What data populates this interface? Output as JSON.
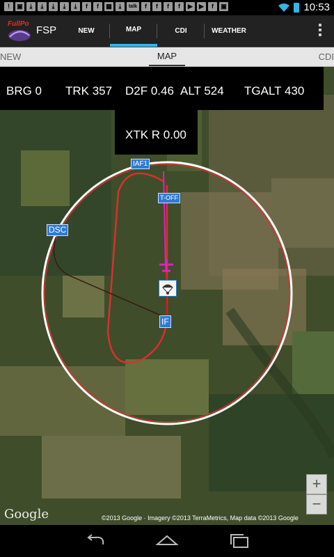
{
  "status_bar": {
    "notification_icons": [
      "notif-alert-icon",
      "image-icon",
      "download-icon",
      "download-icon",
      "download-icon",
      "download-icon",
      "download-icon",
      "facebook-icon",
      "facebook-icon",
      "calendar-icon",
      "download-icon",
      "talk-icon",
      "facebook-icon",
      "facebook-icon",
      "facebook-icon",
      "facebook-icon",
      "media-icon",
      "media-icon",
      "facebook-icon",
      "image-icon"
    ],
    "notification_glyphs": [
      "!",
      "▣",
      "⤓",
      "⤓",
      "⤓",
      "⤓",
      "⤓",
      "f",
      "f",
      "▦",
      "⤓",
      "talk",
      "f",
      "f",
      "f",
      "f",
      "▶",
      "▶",
      "f",
      "▣"
    ],
    "time": "10:53"
  },
  "action_bar": {
    "logo_text": "FullPo",
    "title": "FSP",
    "tabs": [
      {
        "label": "NEW",
        "active": false
      },
      {
        "label": "MAP",
        "active": true
      },
      {
        "label": "CDI",
        "active": false
      },
      {
        "label": "WEATHER",
        "active": false
      }
    ]
  },
  "pager": {
    "left": "NEW",
    "center": "MAP",
    "right": "CDI"
  },
  "nav_info": {
    "brg": "BRG 0",
    "trk": "TRK 357",
    "d2f": "D2F 0.46",
    "alt": "ALT 524",
    "tgalt": "TGALT 430",
    "xtk": "XTK R 0.00"
  },
  "waypoints": {
    "iaf": "IAF1",
    "toff": "T-OFF",
    "dsc": "DSC",
    "if": "IF"
  },
  "map": {
    "zoom_in": "+",
    "zoom_out": "−",
    "google_logo": "Google",
    "copyright": "©2013 Google · Imagery ©2013 TerraMetrics, Map data ©2013 Google"
  },
  "colors": {
    "accent": "#33b5e5",
    "route": "#d83030",
    "circle": "#ffffff",
    "track": "#e020c0"
  }
}
